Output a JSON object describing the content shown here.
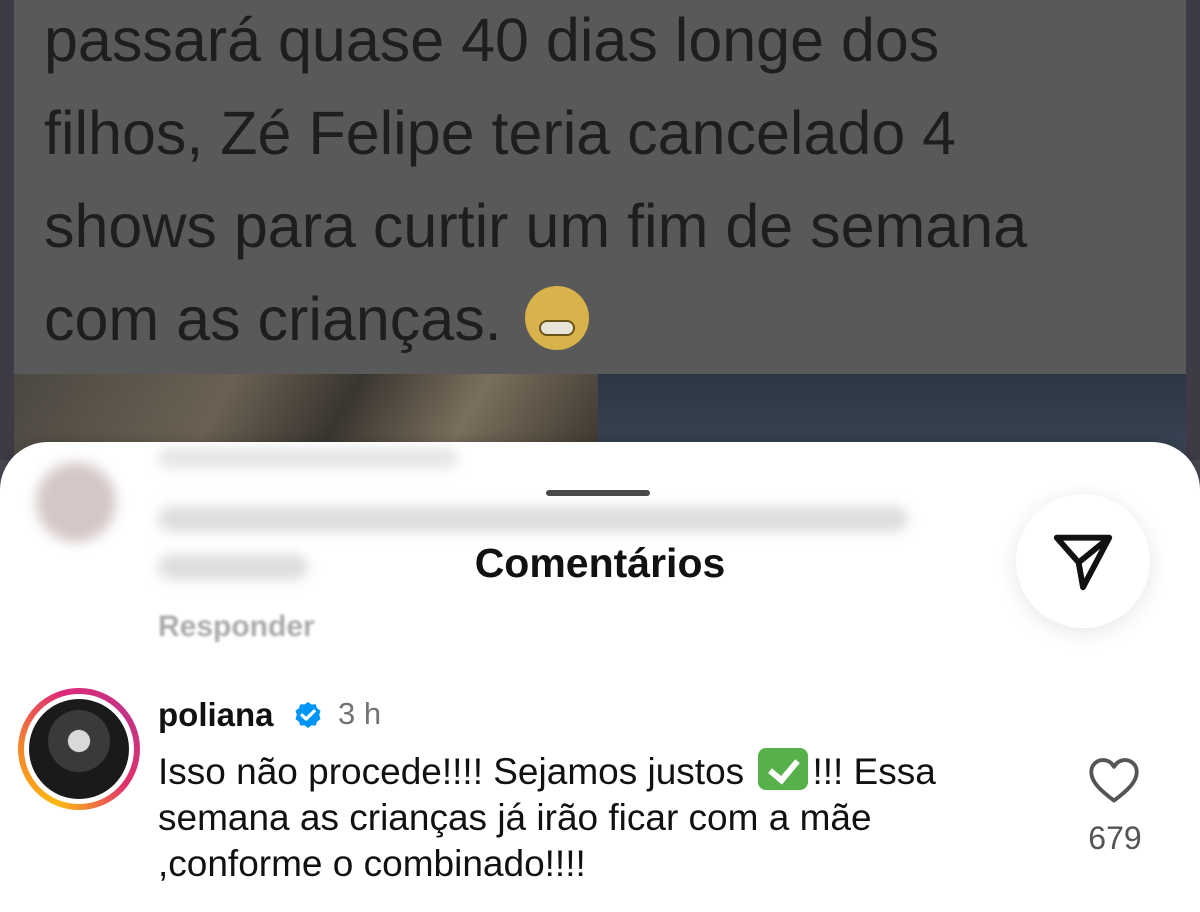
{
  "post": {
    "text_lines": [
      "passará quase 40 dias longe dos",
      "filhos, Zé Felipe teria cancelado 4",
      "shows para curtir um fim de semana",
      "com as crianças."
    ],
    "emoji": "grimacing-face"
  },
  "sheet": {
    "title": "Comentários",
    "reply_label": "Responder",
    "share_icon": "send-icon"
  },
  "comment": {
    "username": "poliana",
    "verified": true,
    "time": "3 h",
    "text_part1": "Isso não procede!!!! Sejamos justos",
    "text_emoji": "check-mark-button",
    "text_part2": "!!! Essa semana as crianças já irão ficar com a mãe ,conforme o combinado!!!!",
    "likes": "679"
  },
  "colors": {
    "verified_blue": "#0095f6",
    "check_green": "#57b14b",
    "ring_gradient": [
      "#fdb913",
      "#f58529",
      "#dd2a7b",
      "#c13584"
    ]
  }
}
